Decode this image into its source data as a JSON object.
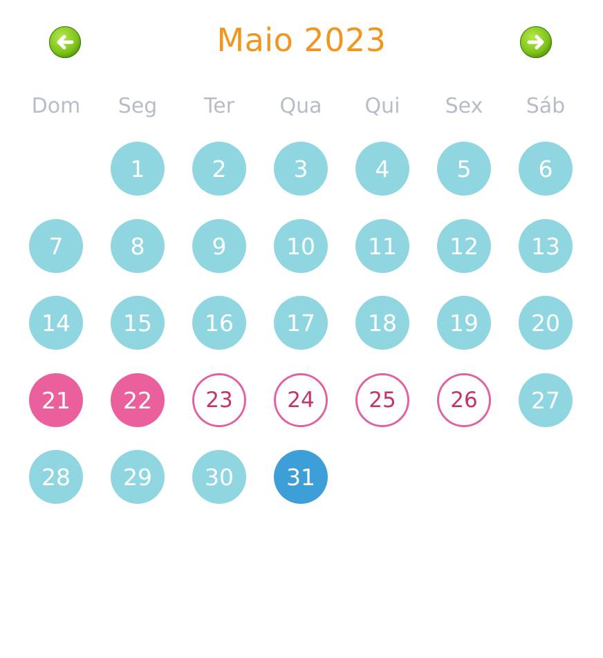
{
  "header": {
    "title": "Maio 2023",
    "prev_icon": "arrow-left-icon",
    "next_icon": "arrow-right-icon"
  },
  "weekdays": [
    "Dom",
    "Seg",
    "Ter",
    "Qua",
    "Qui",
    "Sex",
    "Sáb"
  ],
  "calendar": {
    "first_weekday_index": 1,
    "days": [
      {
        "day": "1",
        "state": "normal"
      },
      {
        "day": "2",
        "state": "normal"
      },
      {
        "day": "3",
        "state": "normal"
      },
      {
        "day": "4",
        "state": "normal"
      },
      {
        "day": "5",
        "state": "normal"
      },
      {
        "day": "6",
        "state": "normal"
      },
      {
        "day": "7",
        "state": "normal"
      },
      {
        "day": "8",
        "state": "normal"
      },
      {
        "day": "9",
        "state": "normal"
      },
      {
        "day": "10",
        "state": "normal"
      },
      {
        "day": "11",
        "state": "normal"
      },
      {
        "day": "12",
        "state": "normal"
      },
      {
        "day": "13",
        "state": "normal"
      },
      {
        "day": "14",
        "state": "normal"
      },
      {
        "day": "15",
        "state": "normal"
      },
      {
        "day": "16",
        "state": "normal"
      },
      {
        "day": "17",
        "state": "normal"
      },
      {
        "day": "18",
        "state": "normal"
      },
      {
        "day": "19",
        "state": "normal"
      },
      {
        "day": "20",
        "state": "normal"
      },
      {
        "day": "21",
        "state": "period"
      },
      {
        "day": "22",
        "state": "period"
      },
      {
        "day": "23",
        "state": "predicted"
      },
      {
        "day": "24",
        "state": "predicted"
      },
      {
        "day": "25",
        "state": "predicted"
      },
      {
        "day": "26",
        "state": "predicted"
      },
      {
        "day": "27",
        "state": "normal"
      },
      {
        "day": "28",
        "state": "normal"
      },
      {
        "day": "29",
        "state": "normal"
      },
      {
        "day": "30",
        "state": "normal"
      },
      {
        "day": "31",
        "state": "today"
      }
    ]
  },
  "colors": {
    "title": "#f0951e",
    "weekday": "#b6bdc9",
    "normal_day": "#8fd6e1",
    "period_day": "#e9609c",
    "predicted_border": "#e060a0",
    "today": "#3e9ed8",
    "nav_button": "#7dc31a"
  }
}
